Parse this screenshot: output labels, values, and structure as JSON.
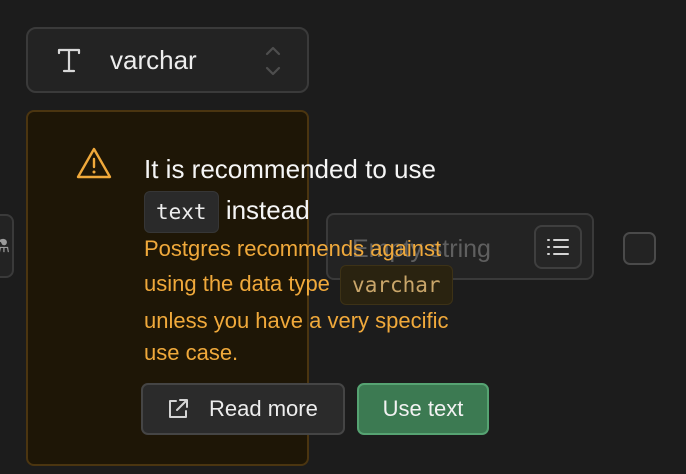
{
  "type_selector": {
    "value": "varchar",
    "type_icon": "text-type-icon",
    "chevron_icon": "chevron-up-down-icon"
  },
  "default_value": {
    "placeholder": "Empty string",
    "list_icon": "list-icon"
  },
  "warning": {
    "icon": "warning-triangle-icon",
    "headline_prefix": "It is recommended to use",
    "headline_code": "text",
    "headline_suffix": "instead",
    "body_prefix": "Postgres recommends against using the data type",
    "body_code": "varchar",
    "body_suffix": "unless you have a very specific use case.",
    "read_more_label": "Read more",
    "read_more_icon": "external-link-icon",
    "use_text_label": "Use text"
  },
  "colors": {
    "warning_text": "#f0a93b",
    "primary_button": "#3c7a52",
    "popover_bg": "#1e1606"
  }
}
